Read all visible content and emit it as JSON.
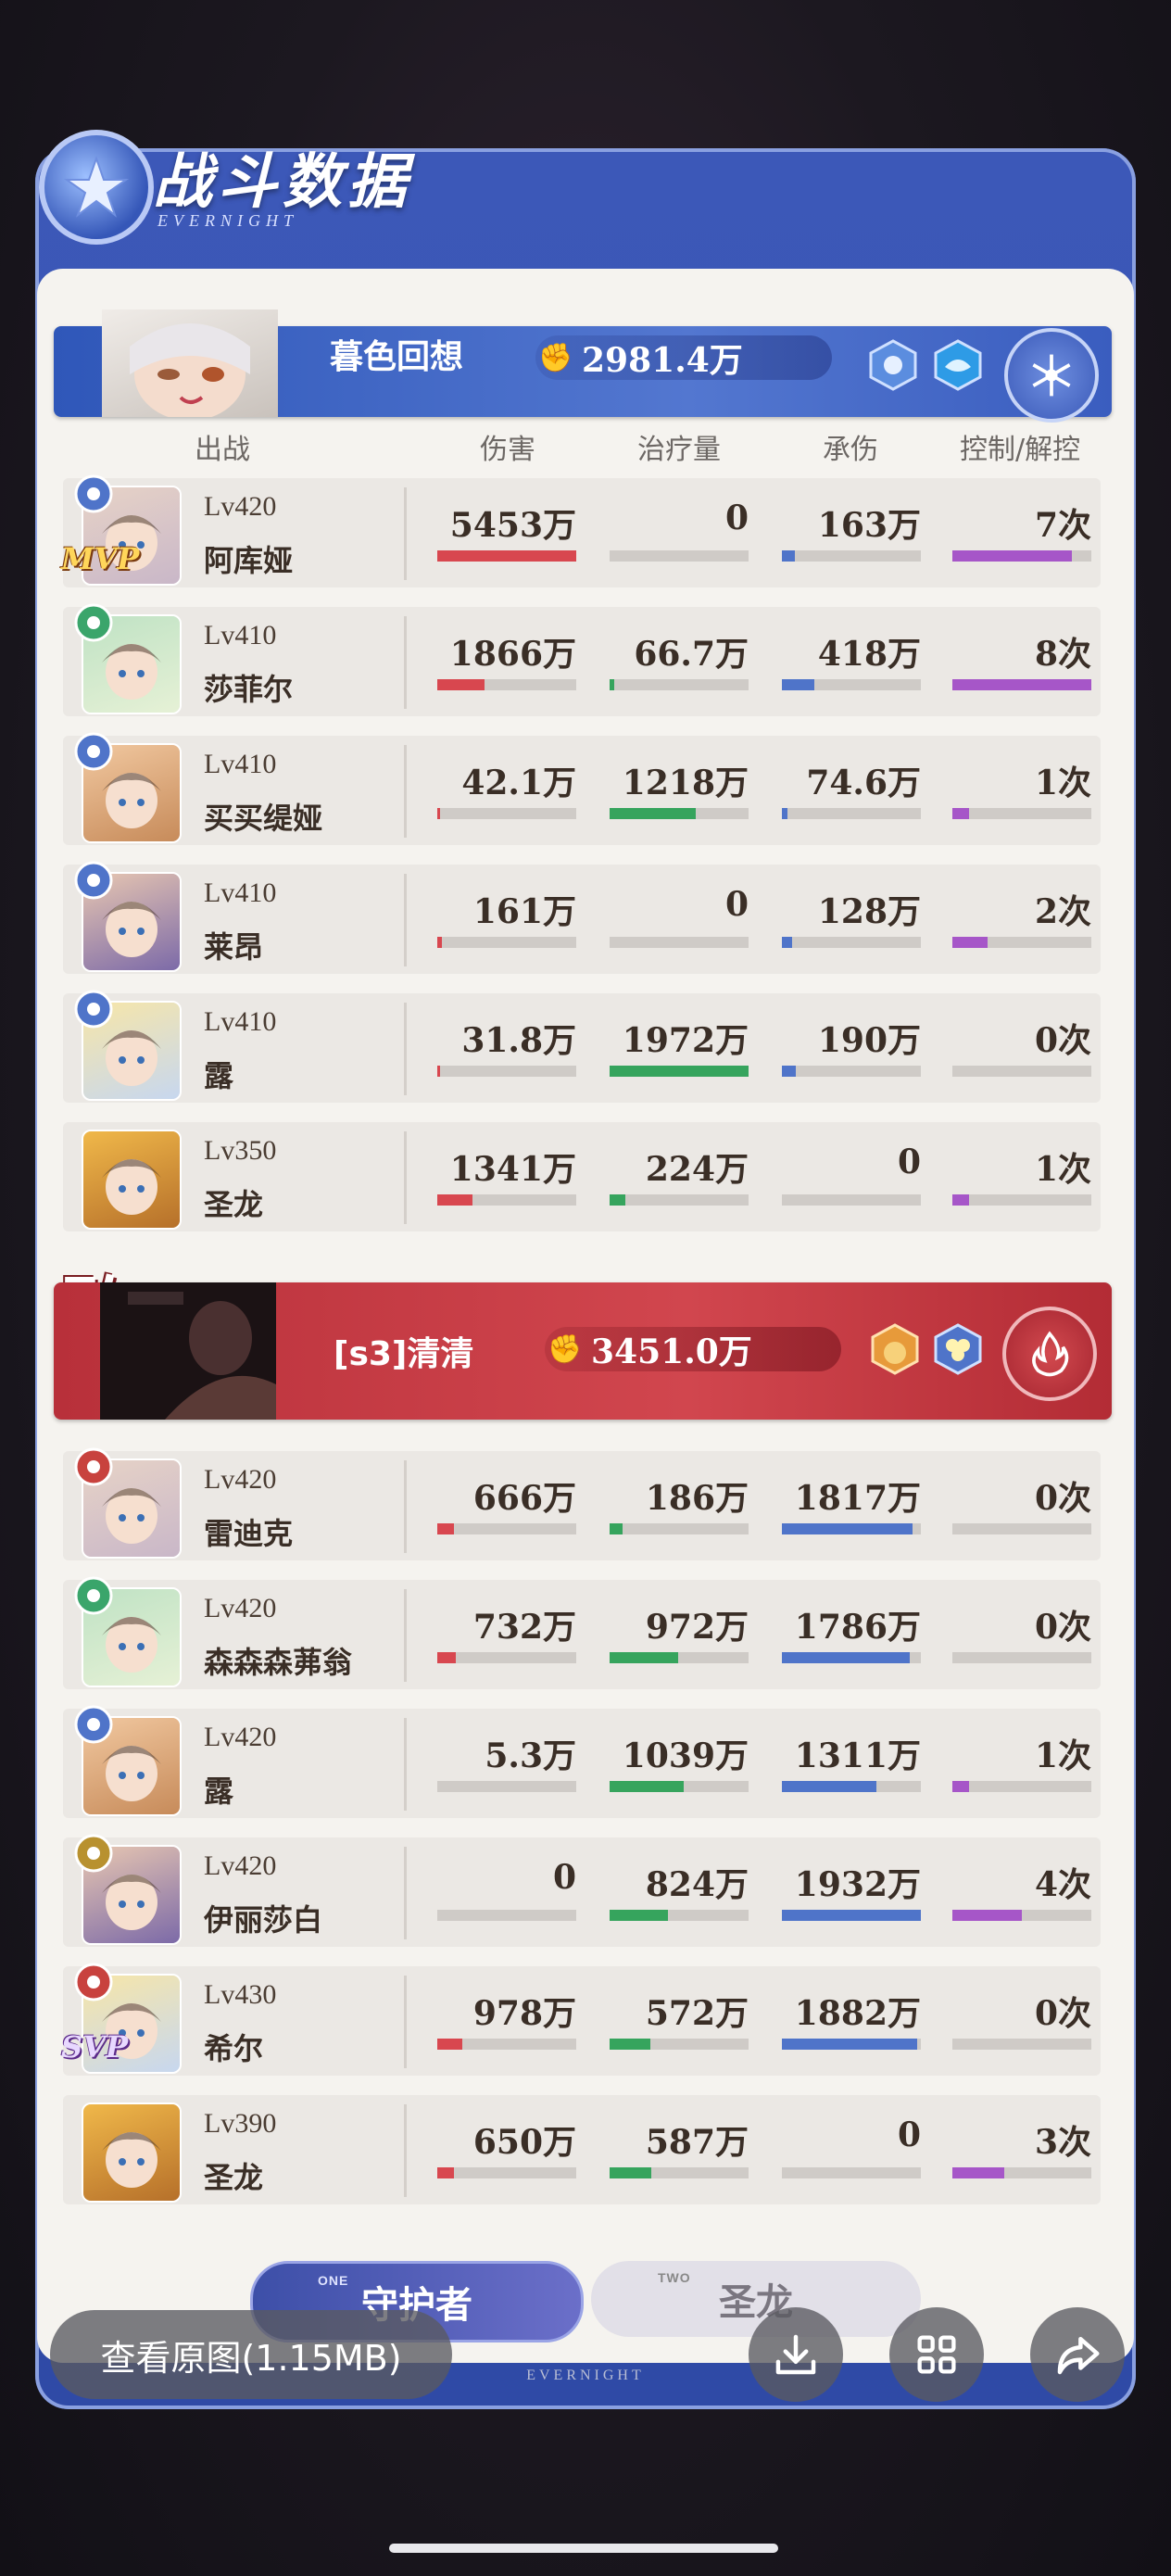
{
  "header": {
    "title": "战斗数据",
    "subtitle": "EVERNIGHT"
  },
  "columns": {
    "deploy": "出战",
    "damage": "伤害",
    "healing": "治疗量",
    "taken": "承伤",
    "control": "控制/解控"
  },
  "colors": {
    "damage": "#d8474f",
    "healing": "#36a45d",
    "taken": "#4f74c9",
    "control": "#a656c8",
    "blue_team": "#3a5dbf",
    "red_team": "#c63a43"
  },
  "team_blue": {
    "name": "暮色回想",
    "power": "2981.4万",
    "icons": [
      "skill-hex-icon",
      "water-hex-icon",
      "ice-element-icon"
    ],
    "players": [
      {
        "level": "Lv420",
        "name": "阿库娅",
        "badge": "MVP",
        "element": "ice",
        "damage": "5453万",
        "healing": "0",
        "taken": "163万",
        "control": "7次",
        "dmg_frac": 1.0,
        "heal_frac": 0.0,
        "taken_frac": 0.09,
        "ctrl_frac": 0.86
      },
      {
        "level": "Lv410",
        "name": "莎菲尔",
        "badge": "",
        "element": "wind",
        "damage": "1866万",
        "healing": "66.7万",
        "taken": "418万",
        "control": "8次",
        "dmg_frac": 0.34,
        "heal_frac": 0.03,
        "taken_frac": 0.23,
        "ctrl_frac": 1.0
      },
      {
        "level": "Lv410",
        "name": "买买缇娅",
        "badge": "",
        "element": "ice",
        "damage": "42.1万",
        "healing": "1218万",
        "taken": "74.6万",
        "control": "1次",
        "dmg_frac": 0.01,
        "heal_frac": 0.62,
        "taken_frac": 0.04,
        "ctrl_frac": 0.12
      },
      {
        "level": "Lv410",
        "name": "莱昂",
        "badge": "",
        "element": "ice",
        "damage": "161万",
        "healing": "0",
        "taken": "128万",
        "control": "2次",
        "dmg_frac": 0.03,
        "heal_frac": 0.0,
        "taken_frac": 0.07,
        "ctrl_frac": 0.25
      },
      {
        "level": "Lv410",
        "name": "露",
        "badge": "",
        "element": "ice",
        "damage": "31.8万",
        "healing": "1972万",
        "taken": "190万",
        "control": "0次",
        "dmg_frac": 0.01,
        "heal_frac": 1.0,
        "taken_frac": 0.1,
        "ctrl_frac": 0.0
      },
      {
        "level": "Lv350",
        "name": "圣龙",
        "badge": "",
        "element": "none",
        "damage": "1341万",
        "healing": "224万",
        "taken": "0",
        "control": "1次",
        "dmg_frac": 0.25,
        "heal_frac": 0.11,
        "taken_frac": 0.0,
        "ctrl_frac": 0.12
      }
    ]
  },
  "team_red": {
    "defeat_mark": "败",
    "name": "[s3]清清",
    "power": "3451.0万",
    "icons": [
      "potion-hex-icon",
      "clover-hex-icon",
      "fire-element-icon"
    ],
    "players": [
      {
        "level": "Lv420",
        "name": "雷迪克",
        "badge": "",
        "element": "fire",
        "damage": "666万",
        "healing": "186万",
        "taken": "1817万",
        "control": "0次",
        "dmg_frac": 0.12,
        "heal_frac": 0.09,
        "taken_frac": 0.94,
        "ctrl_frac": 0.0
      },
      {
        "level": "Lv420",
        "name": "森森森茀翁",
        "badge": "",
        "element": "wind",
        "damage": "732万",
        "healing": "972万",
        "taken": "1786万",
        "control": "0次",
        "dmg_frac": 0.13,
        "heal_frac": 0.49,
        "taken_frac": 0.92,
        "ctrl_frac": 0.0
      },
      {
        "level": "Lv420",
        "name": "露",
        "badge": "",
        "element": "ice",
        "damage": "5.3万",
        "healing": "1039万",
        "taken": "1311万",
        "control": "1次",
        "dmg_frac": 0.0,
        "heal_frac": 0.53,
        "taken_frac": 0.68,
        "ctrl_frac": 0.12
      },
      {
        "level": "Lv420",
        "name": "伊丽莎白",
        "badge": "",
        "element": "earth",
        "damage": "0",
        "healing": "824万",
        "taken": "1932万",
        "control": "4次",
        "dmg_frac": 0.0,
        "heal_frac": 0.42,
        "taken_frac": 1.0,
        "ctrl_frac": 0.5
      },
      {
        "level": "Lv430",
        "name": "希尔",
        "badge": "SVP",
        "element": "fire",
        "damage": "978万",
        "healing": "572万",
        "taken": "1882万",
        "control": "0次",
        "dmg_frac": 0.18,
        "heal_frac": 0.29,
        "taken_frac": 0.97,
        "ctrl_frac": 0.0
      },
      {
        "level": "Lv390",
        "name": "圣龙",
        "badge": "",
        "element": "none",
        "damage": "650万",
        "healing": "587万",
        "taken": "0",
        "control": "3次",
        "dmg_frac": 0.12,
        "heal_frac": 0.3,
        "taken_frac": 0.0,
        "ctrl_frac": 0.37
      }
    ]
  },
  "tabs": [
    {
      "num": "ONE",
      "label": "守护者",
      "active": true
    },
    {
      "num": "TWO",
      "label": "圣龙",
      "active": false
    }
  ],
  "footer": {
    "brand": "EVERNIGHT"
  },
  "overlay": {
    "view_original": "查看原图(1.15MB)",
    "buttons": [
      "download-icon",
      "grid-icon",
      "share-icon"
    ]
  }
}
